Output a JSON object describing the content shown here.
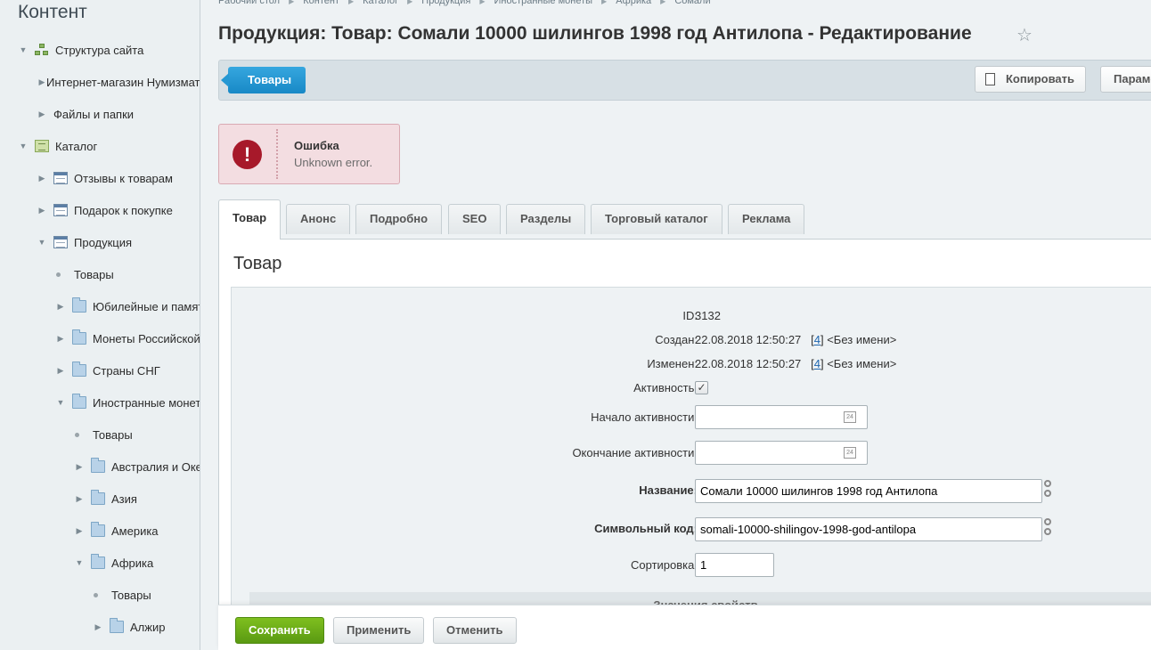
{
  "sidebar": {
    "title": "Контент",
    "items": [
      {
        "label": "Структура сайта",
        "arrow": "▼",
        "icon": "site-structure-icon"
      },
      {
        "label": "Интернет-магазин Нумизмата",
        "arrow": "▶"
      },
      {
        "label": "Файлы и папки",
        "arrow": "▶"
      },
      {
        "label": "Каталог",
        "arrow": "▼",
        "icon": "catalog-icon"
      },
      {
        "label": "Отзывы к товарам",
        "arrow": "▶",
        "icon": "list-icon"
      },
      {
        "label": "Подарок к покупке",
        "arrow": "▶",
        "icon": "list-icon"
      },
      {
        "label": "Продукция",
        "arrow": "▼",
        "icon": "list-icon"
      },
      {
        "label": "Товары"
      },
      {
        "label": "Юбилейные и памятные",
        "arrow": "▶",
        "icon": "folder-icon"
      },
      {
        "label": "Монеты Российской",
        "arrow": "▶",
        "icon": "folder-icon"
      },
      {
        "label": "Страны СНГ",
        "arrow": "▶",
        "icon": "folder-icon"
      },
      {
        "label": "Иностранные монеты",
        "arrow": "▼",
        "icon": "folder-icon"
      },
      {
        "label": "Товары"
      },
      {
        "label": "Австралия и Океания",
        "arrow": "▶",
        "icon": "folder-icon"
      },
      {
        "label": "Азия",
        "arrow": "▶",
        "icon": "folder-icon"
      },
      {
        "label": "Америка",
        "arrow": "▶",
        "icon": "folder-icon"
      },
      {
        "label": "Африка",
        "arrow": "▼",
        "icon": "folder-icon"
      },
      {
        "label": "Товары"
      },
      {
        "label": "Алжир",
        "arrow": "▶",
        "icon": "folder-icon"
      }
    ]
  },
  "breadcrumb": [
    "Рабочий стол",
    "Контент",
    "Каталог",
    "Продукция",
    "Иностранные монеты",
    "Африка",
    "Сомали"
  ],
  "page_title": "Продукция: Товар: Сомали 10000 шилингов 1998 год Антилопа - Редактирование",
  "toolbar": {
    "back_label": "Товары",
    "copy_label": "Копировать",
    "params_label": "Параметры"
  },
  "error": {
    "title": "Ошибка",
    "text": "Unknown error.",
    "icon": "!"
  },
  "tabs": [
    "Товар",
    "Анонс",
    "Подробно",
    "SEO",
    "Разделы",
    "Торговый каталог",
    "Реклама"
  ],
  "section_title": "Товар",
  "form": {
    "id_label": "ID:",
    "id_value": "3132",
    "created_label": "Создан:",
    "created_date": "22.08.2018 12:50:27",
    "created_user_id": "4",
    "created_user_name": "<Без имени>",
    "modified_label": "Изменен:",
    "modified_date": "22.08.2018 12:50:27",
    "modified_user_id": "4",
    "modified_user_name": "<Без имени>",
    "active_label": "Активность:",
    "active_checked": true,
    "start_label": "Начало активности:",
    "start_value": "",
    "end_label": "Окончание активности:",
    "end_value": "",
    "calendar_text": "24",
    "name_label": "Название:",
    "name_value": "Сомали 10000 шилингов 1998 год Антилопа",
    "code_label": "Символьный код:",
    "code_value": "somali-10000-shilingov-1998-god-antilopa",
    "sort_label": "Сортировка:",
    "sort_value": "1",
    "props_header": "Значения свойств"
  },
  "bottom": {
    "save_label": "Сохранить",
    "apply_label": "Применить",
    "cancel_label": "Отменить"
  },
  "colors": {
    "accent_blue": "#1f94d2",
    "save_green": "#6aaa18",
    "error_red": "#a7192a"
  }
}
